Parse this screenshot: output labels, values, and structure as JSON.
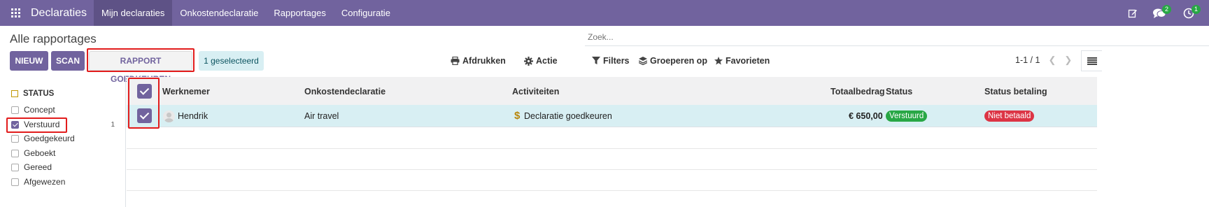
{
  "navbar": {
    "app_name": "Declaraties",
    "menu": [
      "Mijn declaraties",
      "Onkostendeclaratie",
      "Rapportages",
      "Configuratie"
    ],
    "messages_badge": "2",
    "activities_badge": "1"
  },
  "control_panel": {
    "title": "Alle rapportages",
    "search_placeholder": "Zoek...",
    "btn_new": "NIEUW",
    "btn_scan": "SCAN",
    "btn_approve": "RAPPORT GOEDKEUREN",
    "selected": "1 geselecteerd",
    "print": "Afdrukken",
    "action": "Actie",
    "filters": "Filters",
    "group_by": "Groeperen op",
    "favorites": "Favorieten",
    "pager": "1-1 / 1"
  },
  "sidepanel": {
    "header": "STATUS",
    "items": [
      {
        "label": "Concept",
        "checked": false,
        "count": ""
      },
      {
        "label": "Verstuurd",
        "checked": true,
        "count": "1"
      },
      {
        "label": "Goedgekeurd",
        "checked": false,
        "count": ""
      },
      {
        "label": "Geboekt",
        "checked": false,
        "count": ""
      },
      {
        "label": "Gereed",
        "checked": false,
        "count": ""
      },
      {
        "label": "Afgewezen",
        "checked": false,
        "count": ""
      }
    ]
  },
  "table": {
    "columns": [
      "Werknemer",
      "Onkostendeclaratie",
      "Activiteiten",
      "Totaalbedrag",
      "Status",
      "Status betaling"
    ],
    "rows": [
      {
        "employee": "Hendrik",
        "report": "Air travel",
        "activity": "Declaratie goedkeuren",
        "total": "€ 650,00",
        "status": "Verstuurd",
        "payment_status": "Niet betaald"
      }
    ]
  },
  "colors": {
    "brand": "#71639e",
    "selected_row": "#d8eff3",
    "status_green": "#28a745",
    "status_red": "#dc3545",
    "highlight": "#e21c1c"
  }
}
